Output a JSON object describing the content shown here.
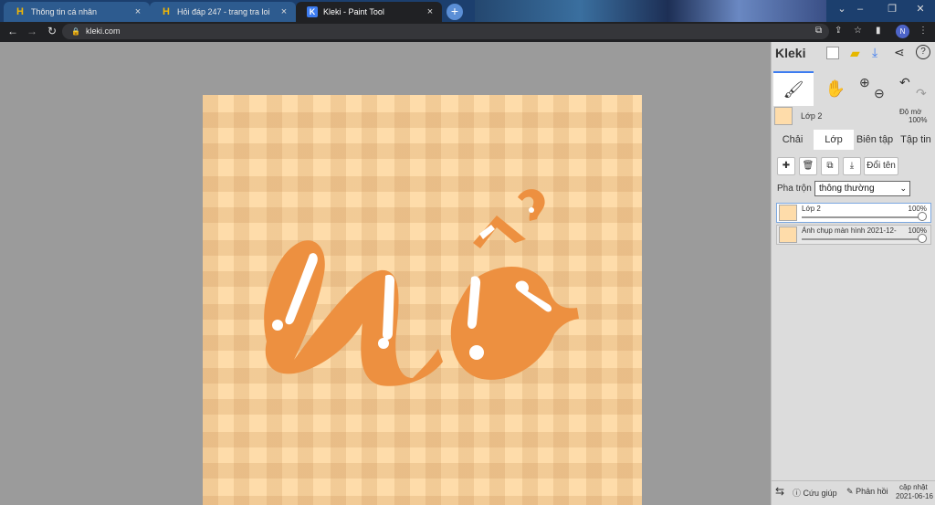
{
  "browser": {
    "tabs": [
      {
        "title": "Thông tin cá nhân",
        "icon": "hoidap-h-icon",
        "active": false
      },
      {
        "title": "Hỏi đáp 247 - trang tra loi",
        "icon": "hoidap-h-icon",
        "active": false
      },
      {
        "title": "Kleki - Paint Tool",
        "icon": "kleki-icon",
        "active": true
      }
    ],
    "favicon_letter": "H",
    "kleki_favicon_letter": "K",
    "close_glyph": "×",
    "new_tab_glyph": "+",
    "window_controls": [
      "⌄",
      "–",
      "❐",
      "✕"
    ],
    "url": "kleki.com",
    "avatar_letter": "N"
  },
  "canvas": {
    "text": "nổ",
    "colors": {
      "background": "#fedcaa",
      "stripe": "#e9b77f",
      "letter": "#ed9040",
      "highlight": "#ffffff"
    }
  },
  "panel": {
    "brand": "Kleki",
    "opacity_label": "Độ mờ",
    "opacity_value": "100%",
    "current_layer": "Lớp 2",
    "tabs": [
      "Chải",
      "Lớp",
      "Biên tập",
      "Tập tin"
    ],
    "active_tab": "Lớp",
    "rename_label": "Đổi tên",
    "blend_label": "Pha trộn",
    "blend_value": "thông thường",
    "layers": [
      {
        "name": "Lớp 2",
        "opacity": "100%"
      },
      {
        "name": "Ảnh chụp màn hình 2021-12-",
        "opacity": "100%"
      }
    ],
    "footer": {
      "help": "Cứu giúp",
      "feedback": "Phản hồi",
      "update_label": "cập nhật",
      "update_date": "2021-06-16"
    }
  }
}
